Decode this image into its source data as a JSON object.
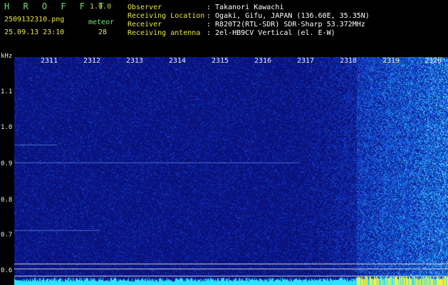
{
  "header": {
    "brand": "H R O F F T",
    "version": "1.0.0",
    "filename": "2509132310.png",
    "datetime": "25.09.13 23:10",
    "meteor_label": "meteor",
    "meteor_count": "28",
    "info_lines": [
      {
        "label": "Observer",
        "value": ": Takanori Kawachi"
      },
      {
        "label": "Receiving Location",
        "value": ": Ogaki, Gifu, JAPAN (136.60E, 35.35N)"
      },
      {
        "label": "Receiver",
        "value": ": R820T2(RTL-SDR) SDR-Sharp 53.372MHz"
      },
      {
        "label": "Receiving antenna",
        "value": ": 2el-HB9CV Vertical (el. E-W)"
      }
    ]
  },
  "axis": {
    "unit": "kHz",
    "freq_ticks": [
      {
        "label": "1.1",
        "value": 1.1
      },
      {
        "label": "1.0",
        "value": 1.0
      },
      {
        "label": "0.9",
        "value": 0.9
      },
      {
        "label": "0.8",
        "value": 0.8
      },
      {
        "label": "0.7",
        "value": 0.7
      },
      {
        "label": "0.6",
        "value": 0.6
      }
    ],
    "minute_ticks": [
      "2311",
      "2312",
      "2313",
      "2314",
      "2315",
      "2316",
      "2317",
      "2318",
      "2319",
      "2320"
    ]
  },
  "colors": {
    "background": "#0a0a6e",
    "noise_low": "#1a2ab0",
    "noise_high": "#30d8ff",
    "strong": "#ffff40",
    "text_label": "#e6e642",
    "text_value": "#ffffff",
    "brand": "#6ee36e"
  }
}
